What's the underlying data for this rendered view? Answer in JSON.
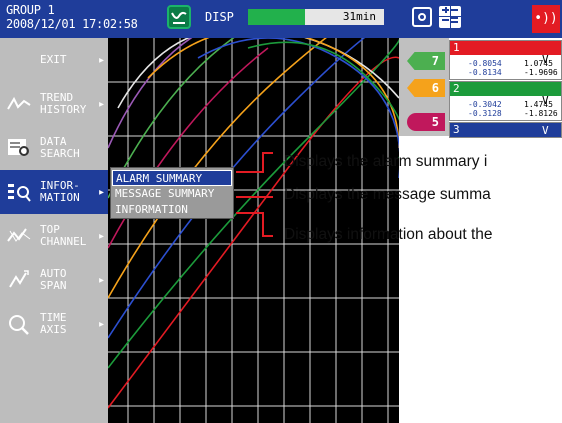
{
  "status_bar": {
    "group": "GROUP 1",
    "datetime": "2008/12/01 17:02:58",
    "disp_label": "DISP",
    "memory_remaining": "31min",
    "memory_fraction": 0.42,
    "icons": [
      "display-mode-icon",
      "snapshot-icon",
      "calculator-icon",
      "alarm-icon"
    ]
  },
  "menu": {
    "items": [
      {
        "label": "EXIT",
        "icon": "",
        "active": false
      },
      {
        "label": "TREND\nHISTORY",
        "icon": "trend-history-icon",
        "active": false
      },
      {
        "label": "DATA\nSEARCH",
        "icon": "data-search-icon",
        "active": false
      },
      {
        "label": "INFOR-\nMATION",
        "icon": "information-icon",
        "active": true
      },
      {
        "label": "TOP\nCHANNEL",
        "icon": "top-channel-icon",
        "active": false
      },
      {
        "label": "AUTO\nSPAN",
        "icon": "auto-span-icon",
        "active": false
      },
      {
        "label": "TIME\nAXIS",
        "icon": "time-axis-icon",
        "active": false
      }
    ]
  },
  "submenu": {
    "items": [
      {
        "label": "ALARM SUMMARY",
        "selected": true
      },
      {
        "label": "MESSAGE SUMMARY",
        "selected": false
      },
      {
        "label": "INFORMATION",
        "selected": false
      }
    ]
  },
  "scale_marks": [
    {
      "label": "7",
      "color": "#4caf50"
    },
    {
      "label": "6",
      "color": "#f5a21b"
    },
    {
      "label": "5",
      "color": "#c0185c"
    }
  ],
  "channels": [
    {
      "num": "1",
      "color": "#e31b23",
      "unit": "V",
      "values": [
        "-0.8054",
        "-0.8134"
      ],
      "values2": [
        "1.0745",
        "-1.9696"
      ]
    },
    {
      "num": "2",
      "color": "#1c9b3b",
      "unit": "V",
      "values": [
        "-0.3042",
        "-0.3128"
      ],
      "values2": [
        "1.4745",
        "-1.8126"
      ]
    },
    {
      "num": "3",
      "color": "#1f3d9a",
      "unit": "V",
      "values": [],
      "values2": []
    }
  ],
  "callouts": [
    "Displays the alarm summary i",
    "Displays the message summa",
    "Displays information about the"
  ],
  "colors": {
    "accent": "#1f3d9a",
    "callout_line": "#e31b23",
    "menu_bg": "#bdbdbd"
  }
}
